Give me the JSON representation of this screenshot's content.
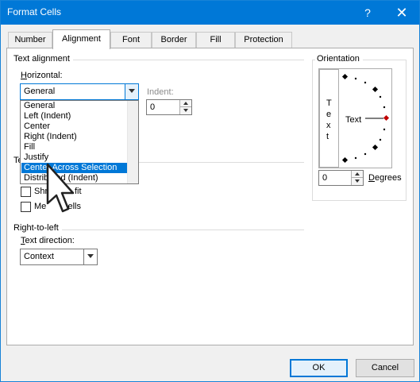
{
  "window": {
    "title": "Format Cells",
    "help_label": "?",
    "close_label": "✕"
  },
  "tabs": [
    {
      "label": "Number",
      "active": false
    },
    {
      "label": "Alignment",
      "active": true
    },
    {
      "label": "Font",
      "active": false
    },
    {
      "label": "Border",
      "active": false
    },
    {
      "label": "Fill",
      "active": false
    },
    {
      "label": "Protection",
      "active": false
    }
  ],
  "text_alignment": {
    "heading": "Text alignment",
    "horizontal_label": "Horizontal:",
    "horizontal_value": "General",
    "horizontal_options": [
      "General",
      "Left (Indent)",
      "Center",
      "Right (Indent)",
      "Fill",
      "Justify",
      "Center Across Selection",
      "Distributed (Indent)"
    ],
    "highlighted_option_index": 6,
    "indent_label": "Indent:",
    "indent_value": "0"
  },
  "text_control": {
    "heading_partial": "Te",
    "shrink_to_fit_visible": "Shr",
    "shrink_to_fit_tail": "fit",
    "merge_cells_visible": "Me",
    "merge_cells_tail": "cells",
    "shrink_checked": false,
    "merge_checked": false
  },
  "right_to_left": {
    "heading": "Right-to-left",
    "text_direction_label": "Text direction:",
    "text_direction_value": "Context"
  },
  "orientation": {
    "heading": "Orientation",
    "vertical_text_letters": [
      "T",
      "e",
      "x",
      "t"
    ],
    "dial_label": "Text",
    "degrees_value": "0",
    "degrees_label": "Degrees"
  },
  "buttons": {
    "ok": "OK",
    "cancel": "Cancel"
  },
  "colors": {
    "titlebar": "#0078d7",
    "selection": "#0078d7",
    "dial_marker": "#c00000"
  }
}
